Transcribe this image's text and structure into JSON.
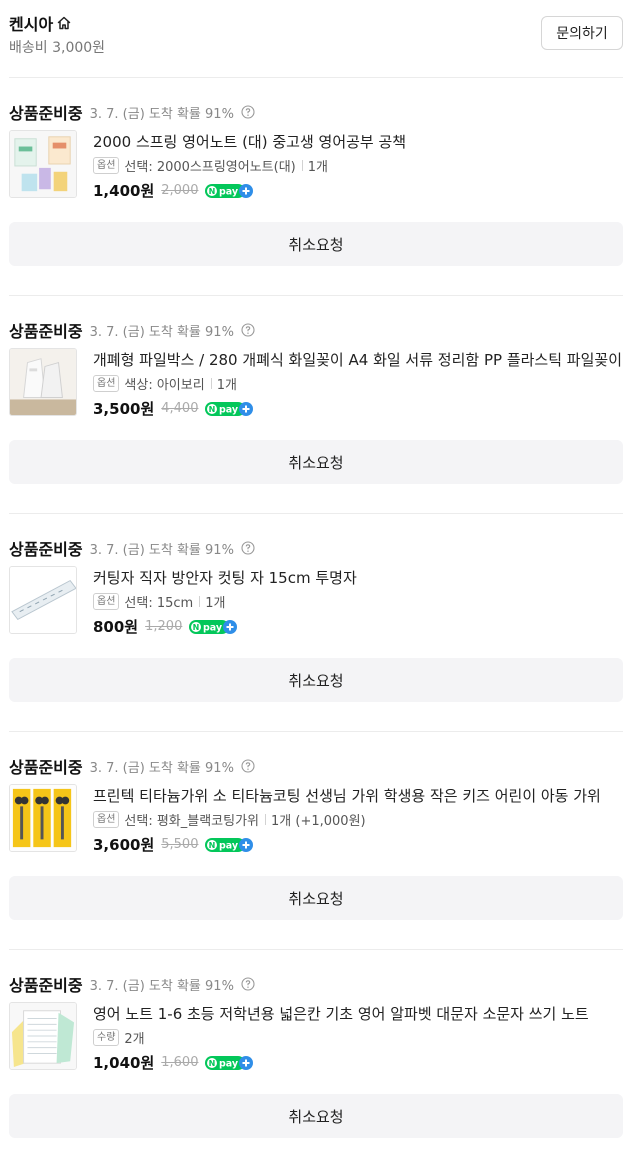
{
  "seller": {
    "name": "켄시아",
    "shipping": "배송비 3,000원",
    "inquiry_label": "문의하기"
  },
  "items": [
    {
      "status": "상품준비중",
      "arrival": "3. 7. (금) 도착 확률 91%",
      "name": "2000 스프링 영어노트 (대) 중고생 영어공부 공책",
      "option_badge": "옵션",
      "option": "선택: 2000스프링영어노트(대)",
      "quantity": "1개",
      "price": "1,400원",
      "original_price": "2,000",
      "pay_label": "pay",
      "cancel_label": "취소요청"
    },
    {
      "status": "상품준비중",
      "arrival": "3. 7. (금) 도착 확률 91%",
      "name": "개폐형 파일박스 / 280 개폐식 화일꽂이 A4 화일 서류 정리함 PP 플라스틱 파일꽂이",
      "option_badge": "옵션",
      "option": "색상: 아이보리",
      "quantity": "1개",
      "price": "3,500원",
      "original_price": "4,400",
      "pay_label": "pay",
      "cancel_label": "취소요청"
    },
    {
      "status": "상품준비중",
      "arrival": "3. 7. (금) 도착 확률 91%",
      "name": "커팅자 직자 방안자 컷팅 자 15cm 투명자",
      "option_badge": "옵션",
      "option": "선택: 15cm",
      "quantity": "1개",
      "price": "800원",
      "original_price": "1,200",
      "pay_label": "pay",
      "cancel_label": "취소요청"
    },
    {
      "status": "상품준비중",
      "arrival": "3. 7. (금) 도착 확률 91%",
      "name": "프린텍 티타늄가위 소 티타늄코팅 선생님 가위 학생용 작은 키즈 어린이 아동 가위",
      "option_badge": "옵션",
      "option": "선택: 평화_블랙코팅가위",
      "quantity": "1개 (+1,000원)",
      "price": "3,600원",
      "original_price": "5,500",
      "pay_label": "pay",
      "cancel_label": "취소요청"
    },
    {
      "status": "상품준비중",
      "arrival": "3. 7. (금) 도착 확률 91%",
      "name": "영어 노트 1-6 초등 저학년용 넓은칸 기초 영어 알파벳 대문자 소문자 쓰기 노트",
      "option_badge": "수량",
      "option": "",
      "quantity": "2개",
      "price": "1,040원",
      "original_price": "1,600",
      "pay_label": "pay",
      "cancel_label": "취소요청"
    }
  ],
  "icons": {
    "home": "home-icon",
    "help": "question-circle-icon",
    "npay": "npay-plus-badge"
  },
  "colors": {
    "npay_green": "#03c75a",
    "npay_blue": "#2f8ee8",
    "cancel_bg": "#f4f4f6"
  }
}
